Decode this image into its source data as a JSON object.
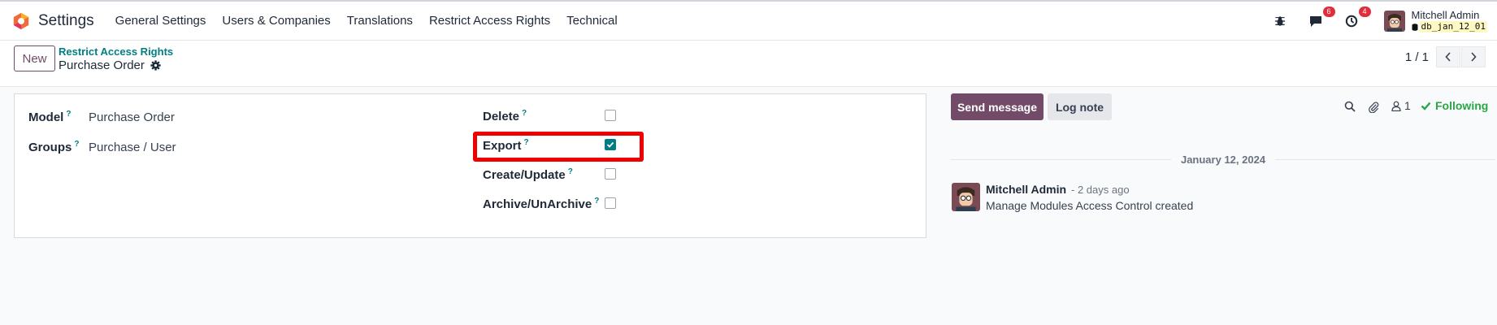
{
  "topbar": {
    "app_name": "Settings",
    "menu": [
      "General Settings",
      "Users & Companies",
      "Translations",
      "Restrict Access Rights",
      "Technical"
    ],
    "messages_badge": "6",
    "activities_badge": "4",
    "user_name": "Mitchell Admin",
    "db_name": "db_jan_12_01"
  },
  "control": {
    "new_label": "New",
    "breadcrumb": "Restrict Access Rights",
    "record_title": "Purchase Order",
    "pager": "1 / 1"
  },
  "form": {
    "model_label": "Model",
    "model_value": "Purchase Order",
    "groups_label": "Groups",
    "groups_value": "Purchase / User",
    "help_mark": "?",
    "delete_label": "Delete",
    "delete_checked": false,
    "export_label": "Export",
    "export_checked": true,
    "create_label": "Create/Update",
    "create_checked": false,
    "archive_label": "Archive/UnArchive",
    "archive_checked": false
  },
  "chatter": {
    "send_label": "Send message",
    "log_label": "Log note",
    "followers_count": "1",
    "following_label": "Following",
    "date_separator": "January 12, 2024",
    "messages": [
      {
        "author": "Mitchell Admin",
        "time": "- 2 days ago",
        "body": "Manage Modules Access Control created"
      }
    ]
  },
  "colors": {
    "brand": "#714b67",
    "teal": "#017e84",
    "following": "#28a745",
    "highlight": "#ee0000",
    "badge": "#e02d3c"
  },
  "icons": [
    "odoo-logo-icon",
    "bug-icon",
    "chat-icon",
    "clock-icon",
    "gear-icon",
    "chevron-left-icon",
    "chevron-right-icon",
    "search-icon",
    "paperclip-icon",
    "user-icon",
    "check-icon"
  ]
}
